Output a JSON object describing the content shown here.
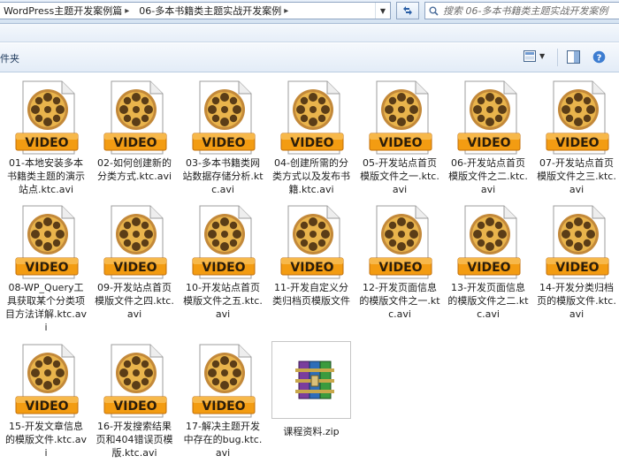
{
  "address": {
    "breadcrumbs": [
      "WordPress主题开发案例篇",
      "06-多本书籍类主题实战开发案例"
    ]
  },
  "search": {
    "placeholder": "搜索 06-多本书籍类主题实战开发案例"
  },
  "toolbar": {
    "folder_label": "件夹"
  },
  "files": [
    {
      "name": "01-本地安装多本书籍类主题的演示站点.ktc.avi",
      "type": "video"
    },
    {
      "name": "02-如何创建新的分类方式.ktc.avi",
      "type": "video"
    },
    {
      "name": "03-多本书籍类网站数据存储分析.ktc.avi",
      "type": "video"
    },
    {
      "name": "04-创建所需的分类方式以及发布书籍.ktc.avi",
      "type": "video"
    },
    {
      "name": "05-开发站点首页模版文件之一.ktc.avi",
      "type": "video"
    },
    {
      "name": "06-开发站点首页模版文件之二.ktc.avi",
      "type": "video"
    },
    {
      "name": "07-开发站点首页模版文件之三.ktc.avi",
      "type": "video"
    },
    {
      "name": "08-WP_Query工具获取某个分类项目方法详解.ktc.avi",
      "type": "video"
    },
    {
      "name": "09-开发站点首页模版文件之四.ktc.avi",
      "type": "video"
    },
    {
      "name": "10-开发站点首页模版文件之五.ktc.avi",
      "type": "video"
    },
    {
      "name": "11-开发自定义分类归档页模版文件",
      "type": "video"
    },
    {
      "name": "12-开发页面信息的模版文件之一.ktc.avi",
      "type": "video"
    },
    {
      "name": "13-开发页面信息的模版文件之二.ktc.avi",
      "type": "video"
    },
    {
      "name": "14-开发分类归档页的模版文件.ktc.avi",
      "type": "video"
    },
    {
      "name": "15-开发文章信息的模版文件.ktc.avi",
      "type": "video"
    },
    {
      "name": "16-开发搜索结果页和404错误页模版.ktc.avi",
      "type": "video"
    },
    {
      "name": "17-解决主题开发中存在的bug.ktc.avi",
      "type": "video"
    },
    {
      "name": "课程资料.zip",
      "type": "archive"
    }
  ],
  "icon_badge": "VIDEO",
  "colors": {
    "badge_orange": "#f39c12",
    "reel_gold": "#e9b44c",
    "toolbar_text": "#1e395b"
  }
}
